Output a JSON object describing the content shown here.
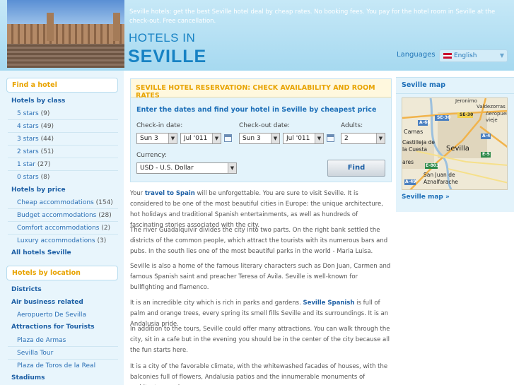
{
  "header": {
    "tagline": "Seville hotels: get the best Seville hotel deal by cheap rates. No booking fees. You pay for the hotel room in Seville at the check-out. Free cancellation.",
    "title_top": "HOTELS IN",
    "title_city": "SEVILLE",
    "languages_label": "Languages",
    "language_selected": "English"
  },
  "sidebar": {
    "find_hotel": "Find a hotel",
    "hotels_by_class": "Hotels by class",
    "class_items": [
      {
        "label": "5 stars",
        "count": "(9)"
      },
      {
        "label": "4 stars",
        "count": "(49)"
      },
      {
        "label": "3 stars",
        "count": "(44)"
      },
      {
        "label": "2 stars",
        "count": "(51)"
      },
      {
        "label": "1 star",
        "count": "(27)"
      },
      {
        "label": "0 stars",
        "count": "(8)"
      }
    ],
    "hotels_by_price": "Hotels by price",
    "price_items": [
      {
        "label": "Cheap accommodations",
        "count": "(154)"
      },
      {
        "label": "Budget accommodations",
        "count": "(28)"
      },
      {
        "label": "Comfort accommodations",
        "count": "(2)"
      },
      {
        "label": "Luxury accommodations",
        "count": "(3)"
      }
    ],
    "all_hotels": "All hotels Seville",
    "hotels_by_location": "Hotels by location",
    "districts": "Districts",
    "air_business": "Air business related",
    "air_items": [
      "Aeropuerto De Sevilla"
    ],
    "attractions": "Attractions for Tourists",
    "attraction_items": [
      "Plaza de Armas",
      "Sevilla Tour",
      "Plaza de Toros de la Real"
    ],
    "stadiums": "Stadiums"
  },
  "reservation": {
    "title": "SEVILLE HOTEL RESERVATION: CHECK AVAILABILITY AND ROOM RATES",
    "subtitle": "Enter the dates and find your hotel in Seville by cheapest price",
    "checkin_label": "Check-in date:",
    "checkin_day": "Sun 3",
    "checkin_month": "Jul '011",
    "checkout_label": "Check-out date:",
    "checkout_day": "Sun 3",
    "checkout_month": "Jul '011",
    "adults_label": "Adults:",
    "adults_value": "2",
    "currency_label": "Currency:",
    "currency_value": "USD - U.S. Dollar",
    "find_button": "Find"
  },
  "content": {
    "p1_a": "Your ",
    "p1_b": "travel to Spain",
    "p1_c": " will be unforgettable. You are sure to visit Seville. It is considered to be one of the most beautiful cities in Europe: the unique architecture, hot holidays and traditional Spanish entertainments, as well as hundreds of fascinating stories associated with the city.",
    "p2": "The river Guadalquivir divides the city into two parts. On the right bank settled the districts of the common people, which attract the tourists with its numerous bars and pubs. In the south lies one of the most beautiful parks in the world - Maria Luisa.",
    "p3": "Seville is also a home of the famous literary characters such as Don Juan, Carmen and famous Spanish saint and preacher Teresa of Avila. Seville is well-known for bullfighting and flamenco.",
    "p4_a": "It is an incredible city which is rich in parks and gardens. ",
    "p4_b": "Seville Spanish",
    "p4_c": " is full of palm and orange trees, every spring its smell fills Seville and its surroundings. It is an Andalusia pride.",
    "p5": "In addition to the tours, Seville could offer many attractions. You can walk through the city, sit in a cafe but in the evening you should be in the center of the city because all the fun starts here.",
    "p6": "It is a city of the favorable climate, with the whitewashed facades of houses, with the balconies full of flowers, Andalusia patios and the innumerable monuments of architecture and"
  },
  "map": {
    "title": "Seville map",
    "link": "Seville map »",
    "labels": [
      "Jeronimo",
      "Valdezorras",
      "Aeropuer",
      "vieje",
      "A-66",
      "SE-30",
      "SE-30",
      "Camas",
      "Castilleja de",
      "la Cuesta",
      "Sevilla",
      "A-4",
      "E-5",
      "E-803",
      "ares",
      "San Juan de",
      "Aznalfarache",
      "A-49"
    ]
  }
}
